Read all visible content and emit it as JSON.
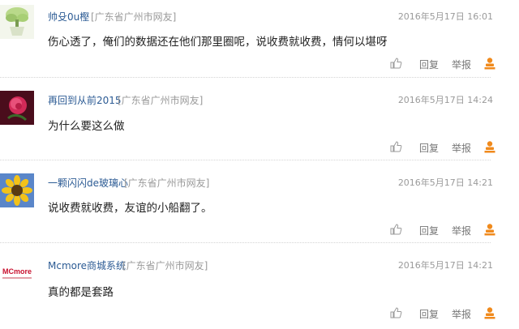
{
  "comments": [
    {
      "username": "帅殳0u樫",
      "location": "[广东省广州市网友]",
      "time": "2016年5月17日 16:01",
      "text": "伤心透了，俺们的数据还在他们那里圈呢，说收费就收费，情何以堪呀",
      "reply_label": "回复",
      "report_label": "举报",
      "avatar_icon": "plant-pot-avatar"
    },
    {
      "username": "再回到从前2015",
      "location": "[广东省广州市网友]",
      "time": "2016年5月17日 14:24",
      "text": "为什么要这么做",
      "reply_label": "回复",
      "report_label": "举报",
      "avatar_icon": "rose-avatar"
    },
    {
      "username": "一颗闪闪de玻璃心",
      "location": "[广东省广州市网友]",
      "time": "2016年5月17日 14:21",
      "text": "说收费就收费，友谊的小船翻了。",
      "reply_label": "回复",
      "report_label": "举报",
      "avatar_icon": "sunflower-avatar"
    },
    {
      "username": "Mcmore商城系统",
      "location": "[广东省广州市网友]",
      "time": "2016年5月17日 14:21",
      "text": "真的都是套路",
      "reply_label": "回复",
      "report_label": "举报",
      "avatar_icon": "mcmore-logo-avatar",
      "avatar_logo_text": "MCmore"
    }
  ],
  "colors": {
    "username": "#2c5b94",
    "meta": "#9a9a9a",
    "body": "#222222",
    "action": "#777777",
    "user_icon": "#f08a1c",
    "divider": "#d4d4d4"
  }
}
